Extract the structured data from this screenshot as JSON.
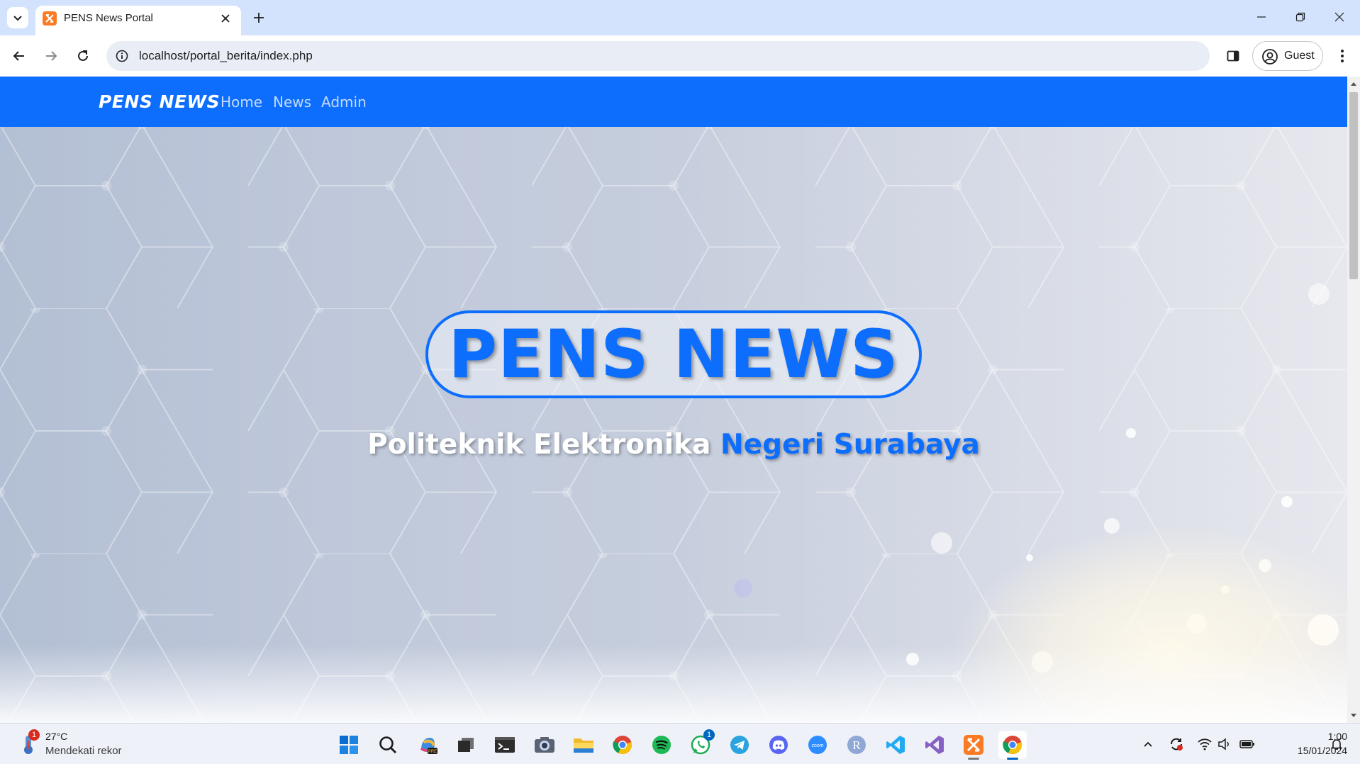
{
  "browser": {
    "tab_title": "PENS News Portal",
    "url": "localhost/portal_berita/index.php",
    "profile_label": "Guest"
  },
  "site": {
    "brand": "PENS NEWS",
    "nav": [
      {
        "label": "Home"
      },
      {
        "label": "News"
      },
      {
        "label": "Admin"
      }
    ],
    "hero_title": "PENS NEWS",
    "hero_subtitle_white": "Politeknik Elektronika",
    "hero_subtitle_blue": "Negeri Surabaya",
    "colors": {
      "primary": "#0d6efd",
      "white": "#ffffff"
    }
  },
  "taskbar": {
    "weather_temp": "27°C",
    "weather_desc": "Mendekati rekor",
    "weather_badge": "1",
    "whatsapp_badge": "1",
    "apps": [
      "windows-start-icon",
      "search-icon",
      "copilot-icon",
      "task-view-icon",
      "terminal-icon",
      "camera-icon",
      "file-explorer-icon",
      "chrome-icon",
      "spotify-icon",
      "whatsapp-icon",
      "telegram-icon",
      "discord-icon",
      "zoom-icon",
      "r-icon",
      "vscode-icon",
      "visual-studio-icon",
      "xampp-icon",
      "chrome-active-icon"
    ],
    "time": "1:00",
    "date": "15/01/2024"
  }
}
